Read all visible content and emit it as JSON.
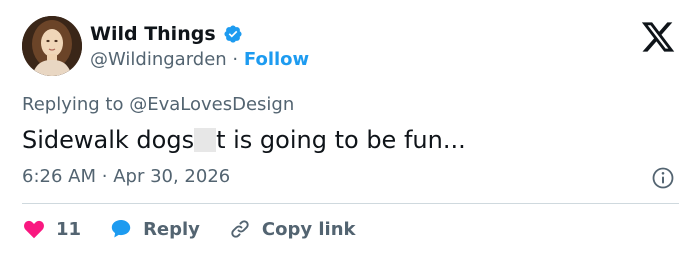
{
  "author": {
    "name": "Wild Things",
    "handle": "@Wildingarden",
    "separator": "·",
    "follow_label": "Follow",
    "verified": true
  },
  "reply": {
    "prefix": "Replying to",
    "to_handle": "@EvaLovesDesign"
  },
  "tweet": {
    "text_before": "Sidewalk dogs",
    "text_after": "t is going to be fun..."
  },
  "meta": {
    "time": "6:26 AM",
    "separator": "·",
    "date": "Apr 30, 2026"
  },
  "actions": {
    "like_count": "11",
    "reply_label": "Reply",
    "copy_link_label": "Copy link"
  },
  "colors": {
    "accent": "#1d9bf0",
    "like": "#f91880",
    "muted": "#536471",
    "text": "#0f1419"
  },
  "icons": {
    "verified": "verified-badge-icon",
    "brand": "x-logo-icon",
    "info": "info-icon",
    "like": "heart-icon",
    "reply": "speech-bubble-icon",
    "copy": "link-icon"
  }
}
